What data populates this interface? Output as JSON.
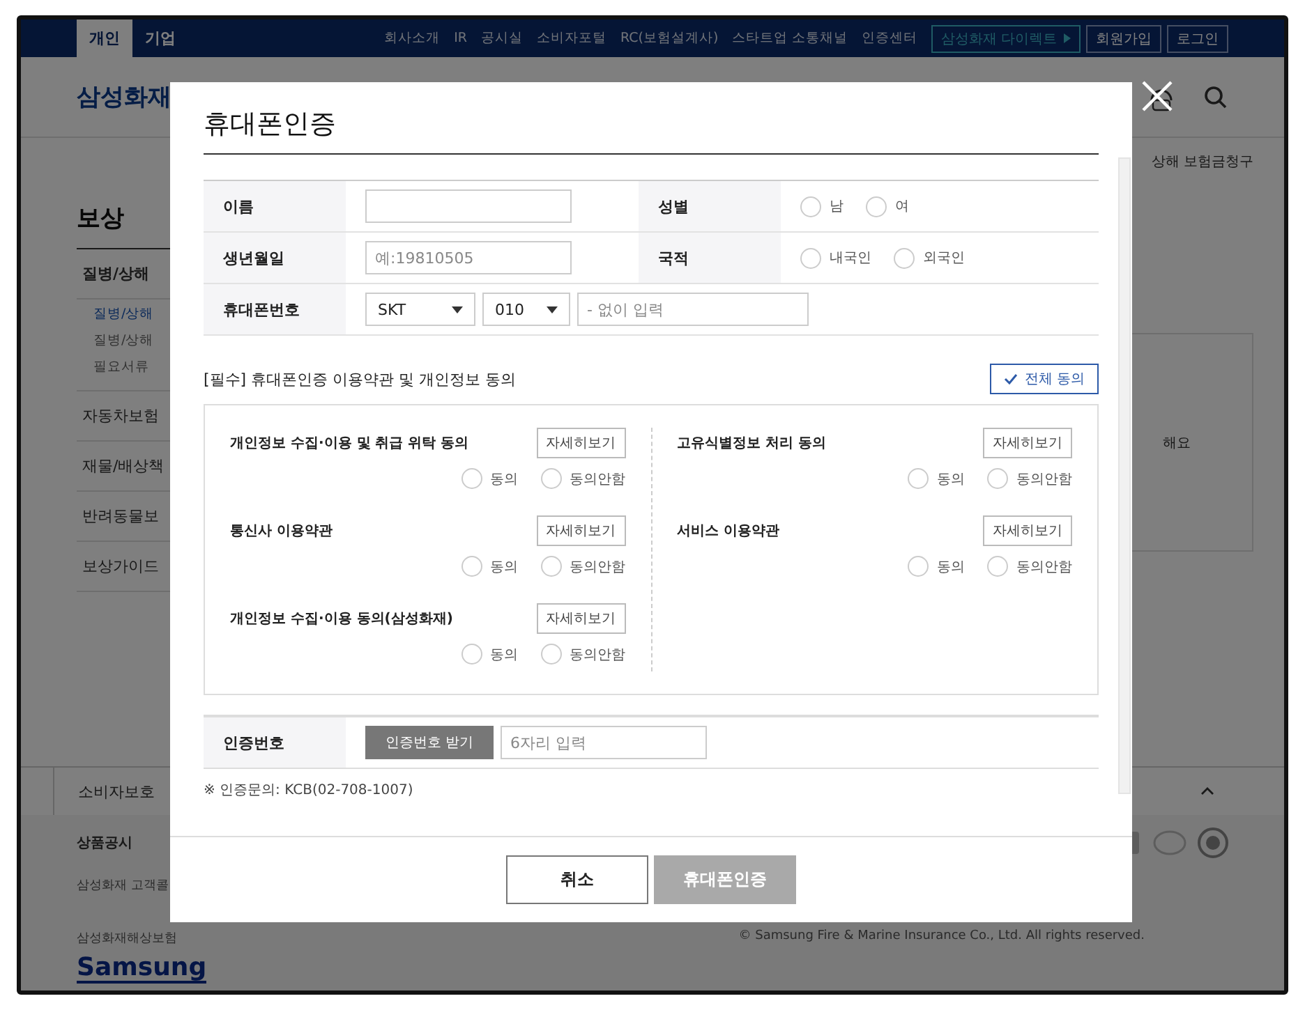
{
  "top_nav": {
    "tabs": [
      {
        "label": "개인",
        "selected": true
      },
      {
        "label": "기업",
        "selected": false
      }
    ],
    "links": [
      "회사소개",
      "IR",
      "공시실",
      "소비자포털",
      "RC(보험설계사)",
      "스타트업 소통채널",
      "인증센터"
    ],
    "direct_button": "삼성화재 다이렉트",
    "buttons": [
      "회원가입",
      "로그인"
    ]
  },
  "header": {
    "logo": "삼성화재"
  },
  "breadcrumb": "상해 보험금청구",
  "sidebar": {
    "title": "보상",
    "items": [
      {
        "label": "질병/상해",
        "children": [
          {
            "label": "질병/상해",
            "selected": true
          },
          {
            "label": "질병/상해",
            "selected": false
          },
          {
            "label": "필요서류",
            "selected": false
          }
        ]
      },
      {
        "label": "자동차보험"
      },
      {
        "label": "재물/배상책"
      },
      {
        "label": "반려동물보"
      },
      {
        "label": "보상가이드"
      }
    ]
  },
  "content_snippet": "해요",
  "footer": {
    "tab": "소비자보호",
    "links": [
      "상품공시"
    ],
    "lines": [
      "삼성화재 고객콜",
      "삼성화재해상보험"
    ],
    "copyright": "© Samsung Fire & Marine Insurance Co., Ltd. All rights reserved.",
    "logo": "Samsung"
  },
  "dialog": {
    "title": "휴대폰인증",
    "rows": [
      [
        {
          "label": "이름",
          "kind": "text"
        },
        {
          "label": "성별",
          "kind": "radio",
          "options": [
            {
              "label": "남",
              "selected": false
            },
            {
              "label": "여",
              "selected": false
            }
          ]
        }
      ],
      [
        {
          "label": "생년월일",
          "kind": "text",
          "placeholder": "예:19810505"
        },
        {
          "label": "국적",
          "kind": "radio",
          "options": [
            {
              "label": "내국인",
              "selected": false
            },
            {
              "label": "외국인",
              "selected": false
            }
          ]
        }
      ],
      [
        {
          "label": "휴대폰번호",
          "kind": "phone",
          "carrier": "SKT",
          "prefix": "010",
          "placeholder": "- 없이 입력"
        }
      ]
    ],
    "consent": {
      "title": "[필수] 휴대폰인증 이용약관 및 개인정보 동의",
      "agree_all": "전체 동의",
      "columns": [
        [
          {
            "label": "개인정보 수집·이용 및 취급 위탁 동의",
            "detail_button": "자세히보기",
            "options": [
              {
                "label": "동의",
                "selected": false
              },
              {
                "label": "동의안함",
                "selected": false
              }
            ]
          },
          {
            "label": "통신사 이용약관",
            "detail_button": "자세히보기",
            "options": [
              {
                "label": "동의",
                "selected": false
              },
              {
                "label": "동의안함",
                "selected": false
              }
            ]
          },
          {
            "label": "개인정보 수집·이용 동의(삼성화재)",
            "detail_button": "자세히보기",
            "options": [
              {
                "label": "동의",
                "selected": false
              },
              {
                "label": "동의안함",
                "selected": false
              }
            ]
          }
        ],
        [
          {
            "label": "고유식별정보 처리 동의",
            "detail_button": "자세히보기",
            "options": [
              {
                "label": "동의",
                "selected": false
              },
              {
                "label": "동의안함",
                "selected": false
              }
            ]
          },
          {
            "label": "서비스 이용약관",
            "detail_button": "자세히보기",
            "options": [
              {
                "label": "동의",
                "selected": false
              },
              {
                "label": "동의안함",
                "selected": false
              }
            ]
          }
        ]
      ]
    },
    "verification": {
      "label": "인증번호",
      "button": "인증번호 받기",
      "placeholder": "6자리 입력"
    },
    "note": "※ 인증문의: KCB(02-708-1007)",
    "buttons": [
      {
        "label": "취소",
        "disabled": false
      },
      {
        "label": "휴대폰인증",
        "disabled": true
      }
    ]
  }
}
